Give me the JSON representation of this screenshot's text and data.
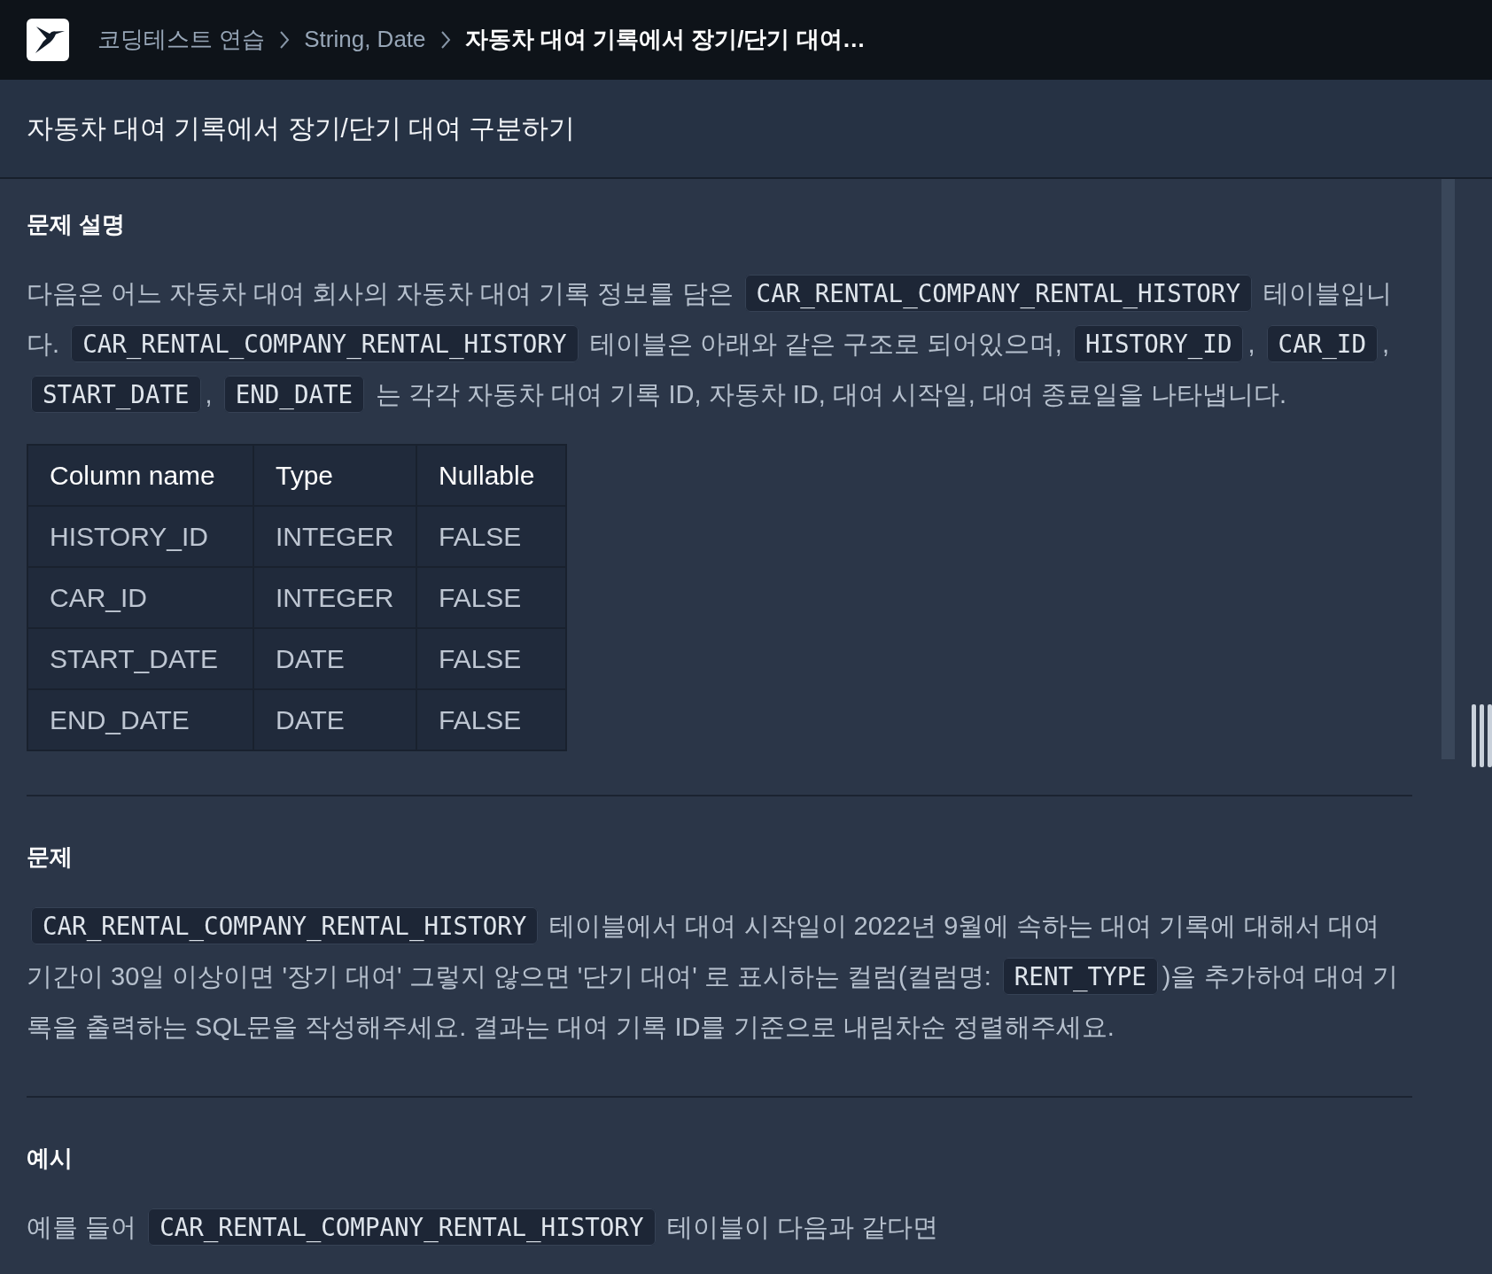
{
  "header": {
    "breadcrumb": [
      {
        "label": "코딩테스트 연습",
        "current": false
      },
      {
        "label": "String, Date",
        "current": false
      },
      {
        "label": "자동차 대여 기록에서 장기/단기 대여…",
        "current": true
      }
    ]
  },
  "title": "자동차 대여 기록에서 장기/단기 대여 구분하기",
  "sections": [
    {
      "heading": "문제 설명",
      "blocks": [
        {
          "kind": "paragraph",
          "runs": [
            {
              "kind": "text",
              "text": "다음은 어느 자동차 대여 회사의 자동차 대여 기록 정보를 담은 "
            },
            {
              "kind": "code",
              "text": "CAR_RENTAL_COMPANY_RENTAL_HISTORY"
            },
            {
              "kind": "text",
              "text": " 테이블입니다. "
            },
            {
              "kind": "code",
              "text": "CAR_RENTAL_COMPANY_RENTAL_HISTORY"
            },
            {
              "kind": "text",
              "text": " 테이블은 아래와 같은 구조로 되어있으며, "
            },
            {
              "kind": "code",
              "text": "HISTORY_ID"
            },
            {
              "kind": "text",
              "text": ", "
            },
            {
              "kind": "code",
              "text": "CAR_ID"
            },
            {
              "kind": "text",
              "text": ", "
            },
            {
              "kind": "code",
              "text": "START_DATE"
            },
            {
              "kind": "text",
              "text": ", "
            },
            {
              "kind": "code",
              "text": "END_DATE"
            },
            {
              "kind": "text",
              "text": " 는 각각 자동차 대여 기록 ID, 자동차 ID, 대여 시작일, 대여 종료일을 나타냅니다."
            }
          ]
        },
        {
          "kind": "table",
          "columns": [
            "Column name",
            "Type",
            "Nullable"
          ],
          "rows": [
            [
              "HISTORY_ID",
              "INTEGER",
              "FALSE"
            ],
            [
              "CAR_ID",
              "INTEGER",
              "FALSE"
            ],
            [
              "START_DATE",
              "DATE",
              "FALSE"
            ],
            [
              "END_DATE",
              "DATE",
              "FALSE"
            ]
          ]
        }
      ]
    },
    {
      "heading": "문제",
      "blocks": [
        {
          "kind": "paragraph",
          "runs": [
            {
              "kind": "code",
              "text": "CAR_RENTAL_COMPANY_RENTAL_HISTORY"
            },
            {
              "kind": "text",
              "text": " 테이블에서 대여 시작일이 2022년 9월에 속하는 대여 기록에 대해서 대여 기간이 30일 이상이면 '장기 대여' 그렇지 않으면 '단기 대여' 로 표시하는 컬럼(컬럼명: "
            },
            {
              "kind": "code",
              "text": "RENT_TYPE"
            },
            {
              "kind": "text",
              "text": ")을 추가하여 대여 기록을 출력하는 SQL문을 작성해주세요. 결과는 대여 기록 ID를 기준으로 내림차순 정렬해주세요."
            }
          ]
        }
      ]
    },
    {
      "heading": "예시",
      "blocks": [
        {
          "kind": "paragraph",
          "runs": [
            {
              "kind": "text",
              "text": "예를 들어 "
            },
            {
              "kind": "code",
              "text": "CAR_RENTAL_COMPANY_RENTAL_HISTORY"
            },
            {
              "kind": "text",
              "text": " 테이블이 다음과 같다면"
            }
          ]
        }
      ]
    }
  ]
}
